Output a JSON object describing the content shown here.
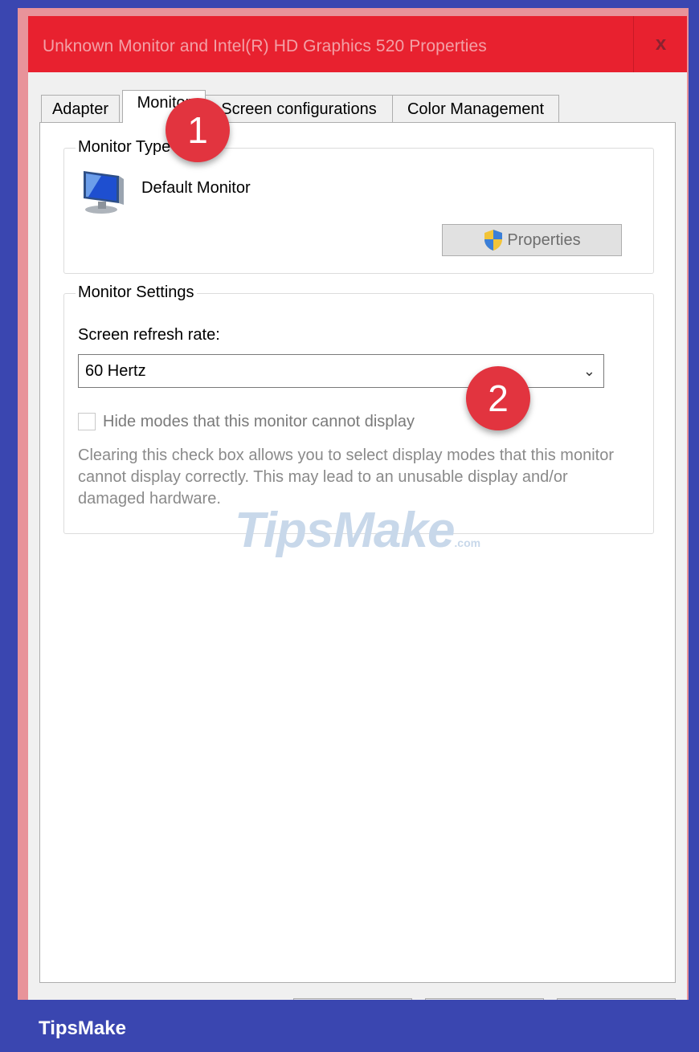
{
  "window": {
    "title": "Unknown Monitor and Intel(R) HD Graphics 520 Properties",
    "close_label": "x"
  },
  "tabs": [
    {
      "label": "Adapter"
    },
    {
      "label": "Monitor"
    },
    {
      "label": "Screen configurations"
    },
    {
      "label": "Color Management"
    }
  ],
  "monitor_type": {
    "legend": "Monitor Type",
    "name": "Default Monitor",
    "icon": "monitor-icon",
    "properties_label": "Properties"
  },
  "monitor_settings": {
    "legend": "Monitor Settings",
    "refresh_label": "Screen refresh rate:",
    "refresh_value": "60 Hertz",
    "hide_modes_label": "Hide modes that this monitor cannot display",
    "hide_modes_checked": false,
    "description": "Clearing this check box allows you to select display modes that this monitor cannot display correctly. This may lead to an unusable display and/or damaged hardware."
  },
  "annotations": [
    "1",
    "2"
  ],
  "watermark": {
    "main": "TipsMake",
    "suffix": ".com"
  },
  "footer": {
    "brand": "TipsMake"
  },
  "colors": {
    "titlebar": "#e8212f",
    "frame": "#3a46b0",
    "badge": "#e2343f"
  }
}
